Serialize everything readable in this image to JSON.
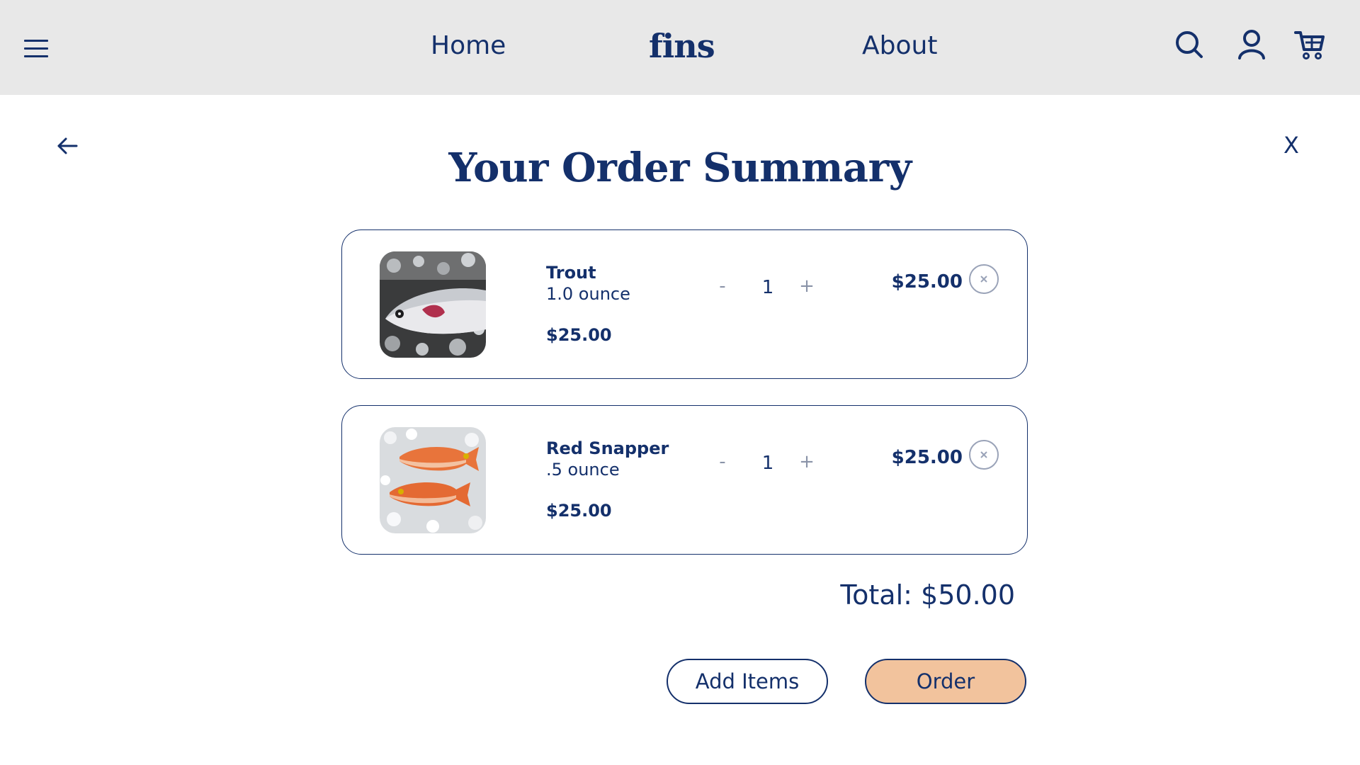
{
  "header": {
    "nav_home": "Home",
    "logo": "fins",
    "nav_about": "About",
    "icons": [
      "menu-icon",
      "search-icon",
      "user-icon",
      "cart-icon"
    ]
  },
  "page": {
    "close_label": "X",
    "title": "Your Order Summary",
    "back_icon": "arrow-left-icon"
  },
  "cart": {
    "items": [
      {
        "name": "Trout",
        "weight": "1.0 ounce",
        "unit_price": "$25.00",
        "quantity": "1",
        "minus": "-",
        "plus": "+",
        "line_total": "$25.00"
      },
      {
        "name": "Red Snapper",
        "weight": ".5 ounce",
        "unit_price": "$25.00",
        "quantity": "1",
        "minus": "-",
        "plus": "+",
        "line_total": "$25.00"
      }
    ],
    "total": "Total: $50.00"
  },
  "actions": {
    "add_items": "Add Items",
    "order": "Order"
  },
  "colors": {
    "navy": "#14306b",
    "header_bg": "#e8e8e8",
    "order_button": "#f2c39d"
  }
}
